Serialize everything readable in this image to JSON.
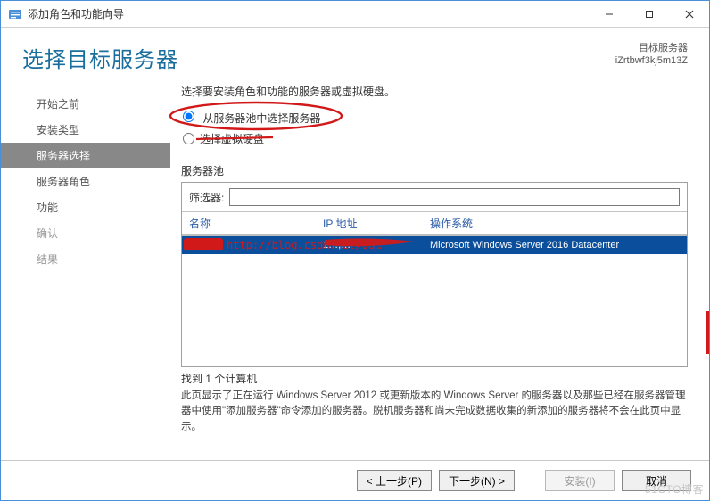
{
  "titlebar": {
    "title": "添加角色和功能向导"
  },
  "header": {
    "page_title": "选择目标服务器",
    "dest_label": "目标服务器",
    "dest_value": "iZrtbwf3kj5m13Z"
  },
  "nav": {
    "items": [
      {
        "label": "开始之前",
        "state": "enabled"
      },
      {
        "label": "安装类型",
        "state": "enabled"
      },
      {
        "label": "服务器选择",
        "state": "active"
      },
      {
        "label": "服务器角色",
        "state": "enabled"
      },
      {
        "label": "功能",
        "state": "enabled"
      },
      {
        "label": "确认",
        "state": "disabled"
      },
      {
        "label": "结果",
        "state": "disabled"
      }
    ]
  },
  "content": {
    "instruction": "选择要安装角色和功能的服务器或虚拟硬盘。",
    "radio1": "从服务器池中选择服务器",
    "radio2": "选择虚拟硬盘",
    "pool_label": "服务器池",
    "filter_label": "筛选器:",
    "filter_value": "",
    "columns": {
      "name": "名称",
      "ip": "IP 地址",
      "os": "操作系统"
    },
    "row": {
      "name_masked": "",
      "ip_masked": "1…,…",
      "os": "Microsoft Windows Server 2016 Datacenter"
    },
    "found": "找到 1 个计算机",
    "explain": "此页显示了正在运行 Windows Server 2012 或更新版本的 Windows Server 的服务器以及那些已经在服务器管理器中使用\"添加服务器\"命令添加的服务器。脱机服务器和尚未完成数据收集的新添加的服务器将不会在此页中显示。"
  },
  "footer": {
    "prev": "< 上一步(P)",
    "next": "下一步(N) >",
    "install": "安装(I)",
    "cancel": "取消"
  },
  "watermark": "51CTO博客",
  "annotation_url": "http://blog.csdn.net/qq…"
}
